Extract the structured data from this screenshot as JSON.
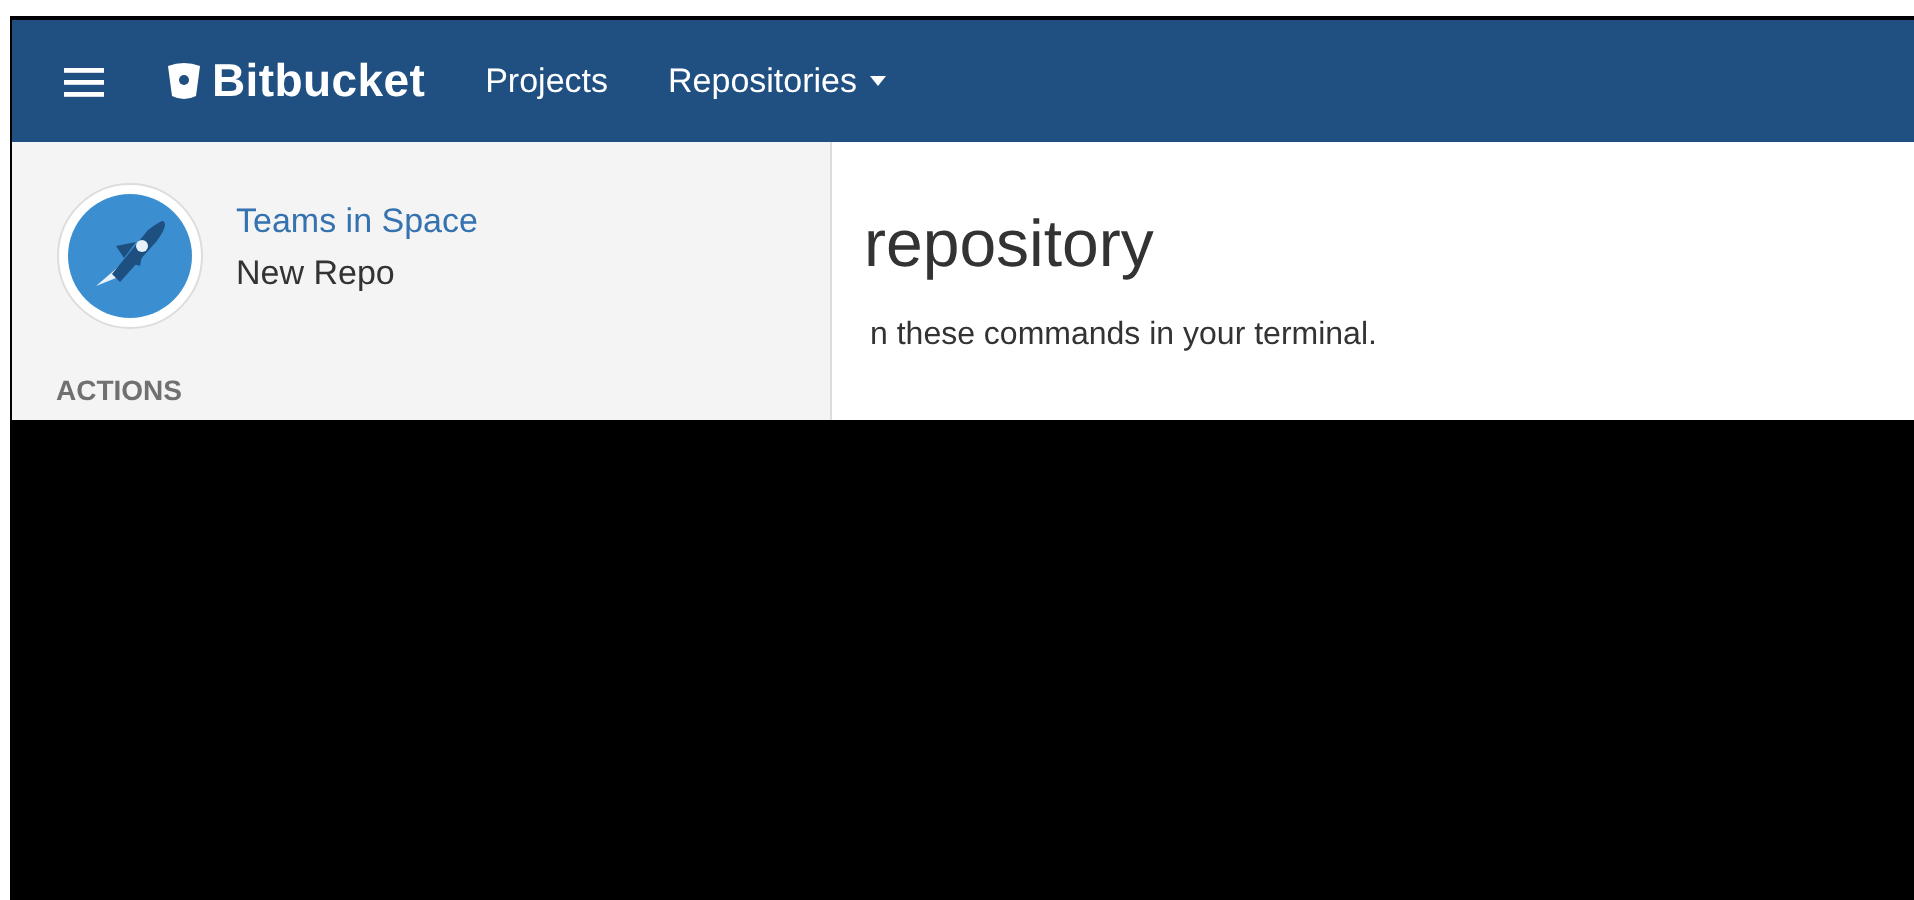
{
  "navbar": {
    "brand": "Bitbucket",
    "items": [
      {
        "label": "Projects",
        "dropdown": false
      },
      {
        "label": "Repositories",
        "dropdown": true
      }
    ]
  },
  "sidebar": {
    "project": "Teams in Space",
    "repo": "New Repo",
    "section": "ACTIONS"
  },
  "content": {
    "heading": "repository",
    "text": "n these commands in your terminal."
  }
}
